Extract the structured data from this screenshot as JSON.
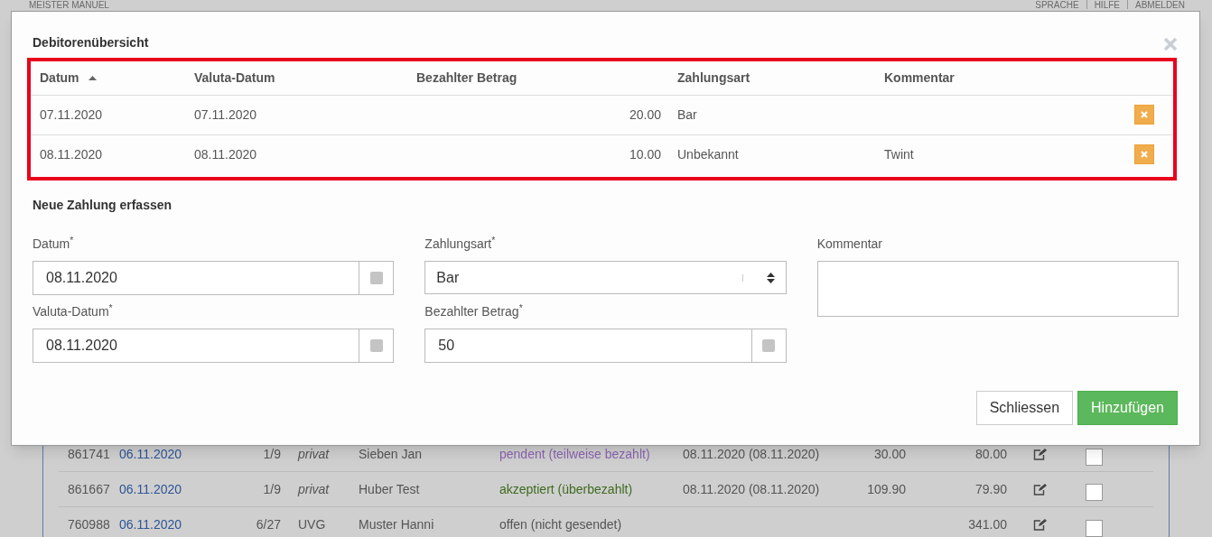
{
  "header": {
    "brand": "MEISTER MANUEL",
    "links": [
      "SPRACHE",
      "HILFE",
      "ABMELDEN"
    ]
  },
  "background_table": {
    "rows": [
      {
        "cells": [
          "861741",
          "06.11.2020",
          "1/9",
          "privat",
          "Sieben Jan"
        ],
        "status": {
          "text": "pendent (teilweise bezahlt)",
          "color": "#8a63b0"
        },
        "period": "08.11.2020 (08.11.2020)",
        "amount_1": "30.00",
        "amount_2": "80.00",
        "checked": false
      },
      {
        "cells": [
          "861667",
          "06.11.2020",
          "1/9",
          "privat",
          "Huber Test"
        ],
        "status": {
          "text": "akzeptiert (überbezahlt)",
          "color": "#3f6b1f"
        },
        "period": "08.11.2020 (08.11.2020)",
        "amount_1": "109.90",
        "amount_2": "79.90",
        "checked": false
      },
      {
        "cells": [
          "760988",
          "06.11.2020",
          "6/27",
          "UVG",
          "Muster Hanni"
        ],
        "status": {
          "text": "offen (nicht gesendet)",
          "color": "#555555"
        },
        "period": "",
        "amount_1": "",
        "amount_2": "341.00",
        "checked": false
      }
    ]
  },
  "modal": {
    "title": "Debitorenübersicht",
    "table": {
      "columns": [
        {
          "label": "Datum",
          "sorted": true
        },
        {
          "label": "Valuta-Datum",
          "sorted": false
        },
        {
          "label": "Bezahlter Betrag",
          "sorted": false
        },
        {
          "label": "Zahlungsart",
          "sorted": false
        },
        {
          "label": "Kommentar",
          "sorted": false
        }
      ],
      "rows": [
        {
          "cells": [
            "07.11.2020",
            "07.11.2020",
            "20.00",
            "Bar",
            ""
          ]
        },
        {
          "cells": [
            "08.11.2020",
            "08.11.2020",
            "10.00",
            "Unbekannt",
            "Twint"
          ]
        }
      ]
    },
    "form": {
      "title": "Neue Zahlung erfassen",
      "fields": [
        {
          "kind": "date",
          "label": "Datum$^{*}$",
          "value": "08.11.2020"
        },
        {
          "kind": "date",
          "label": "Valuta-Datum$^{*}$",
          "value": "08.11.2020"
        },
        {
          "kind": "select",
          "label": "Zahlungsart$^{*}$",
          "value": "Bar"
        },
        {
          "kind": "number",
          "label": "Bezahlter Betrag$^{*}$",
          "value": "50"
        },
        {
          "kind": "textarea",
          "label": "Kommentar"
        }
      ]
    },
    "buttons": [
      {
        "label": "Schliessen",
        "kind": "default"
      },
      {
        "label": "Hinzufügen",
        "kind": "primary"
      }
    ]
  }
}
